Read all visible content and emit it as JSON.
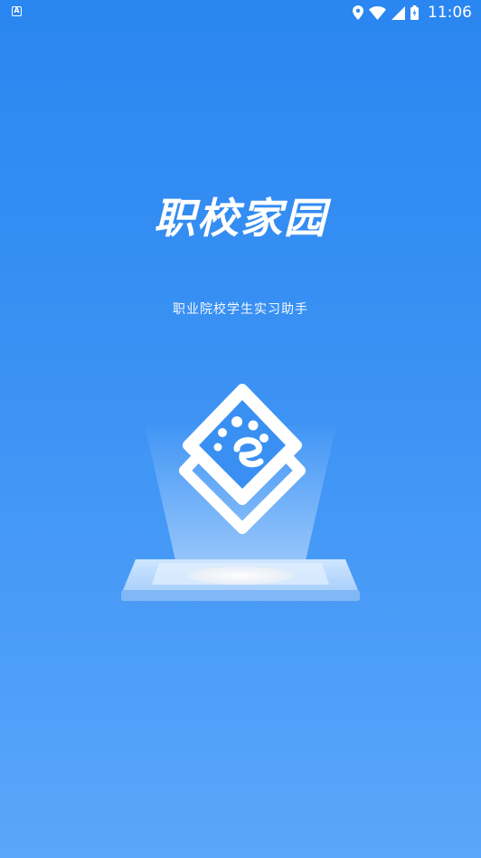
{
  "status_bar": {
    "notification_glyph": "A",
    "time": "11:06",
    "icons": [
      "location-icon",
      "wifi-icon",
      "signal-icon",
      "battery-icon"
    ]
  },
  "splash": {
    "title": "职校家园",
    "subtitle": "职业院校学生实习助手"
  },
  "colors": {
    "background_top": "#2a86f0",
    "background_bottom": "#5aa6fb",
    "logo_frame": "#ffffff",
    "logo_dots": "#4a9cf4"
  }
}
